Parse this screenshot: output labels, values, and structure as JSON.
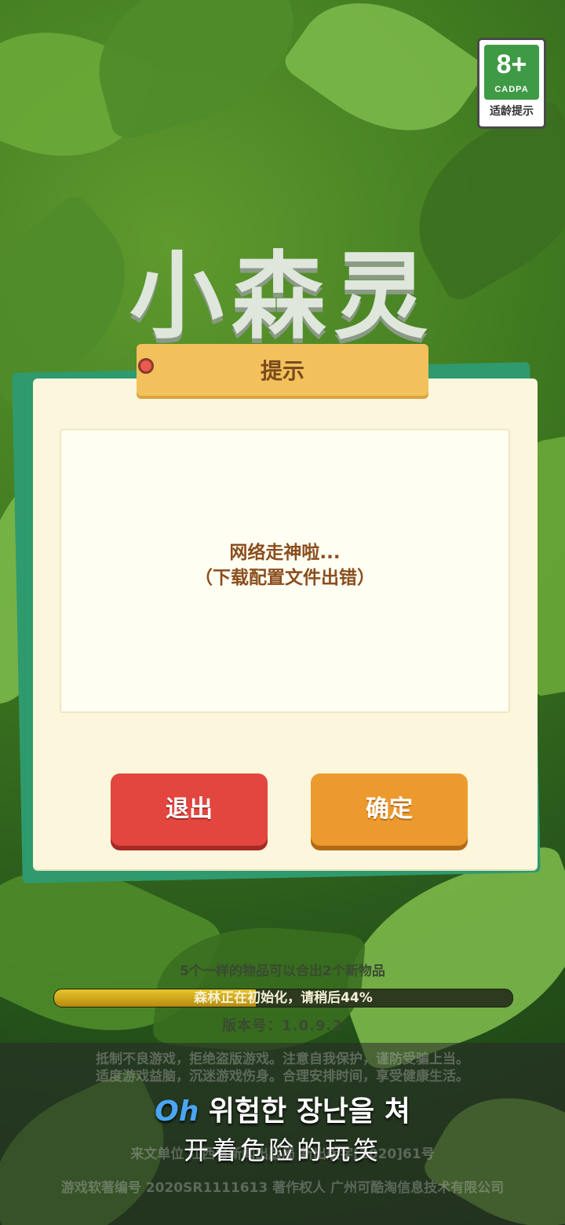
{
  "rating": {
    "age": "8+",
    "org": "CADPA",
    "hint": "适龄提示"
  },
  "game": {
    "logo_text": "小森灵"
  },
  "dialog": {
    "title": "提示",
    "message_line1": "网络走神啦...",
    "message_line2": "（下载配置文件出错）",
    "exit_label": "退出",
    "ok_label": "确定"
  },
  "loading": {
    "tip": "5个一样的物品可以合出2个新物品",
    "progress_text": "森林正在初始化，请稍后44%",
    "progress_fraction": 0.44,
    "version": "版本号：1.0.9.2"
  },
  "footer": {
    "notice_line1": "抵制不良游戏，拒绝盗版游戏。注意自我保护，谨防受骗上当。",
    "notice_line2": "适度游戏益脑，沉迷游戏伤身。合理安排时间，享受健康生活。",
    "publisher_line": "来文单位   江西省新闻出版局   新出版字[2020]61号",
    "copyright_line": "游戏软著编号 2020SR1111613 著作权人 广州可酷淘信息技术有限公司"
  },
  "subtitle": {
    "line1_highlight": "Oh",
    "line1_rest": " 위험한 장난을 쳐",
    "line2": "开着危险的玩笑"
  },
  "colors": {
    "exit_button": "#e2463f",
    "ok_button": "#ec9a2e",
    "dialog_bg": "#fbf6dc",
    "title_tag": "#f2c15b",
    "rating_green": "#3f9a45"
  }
}
